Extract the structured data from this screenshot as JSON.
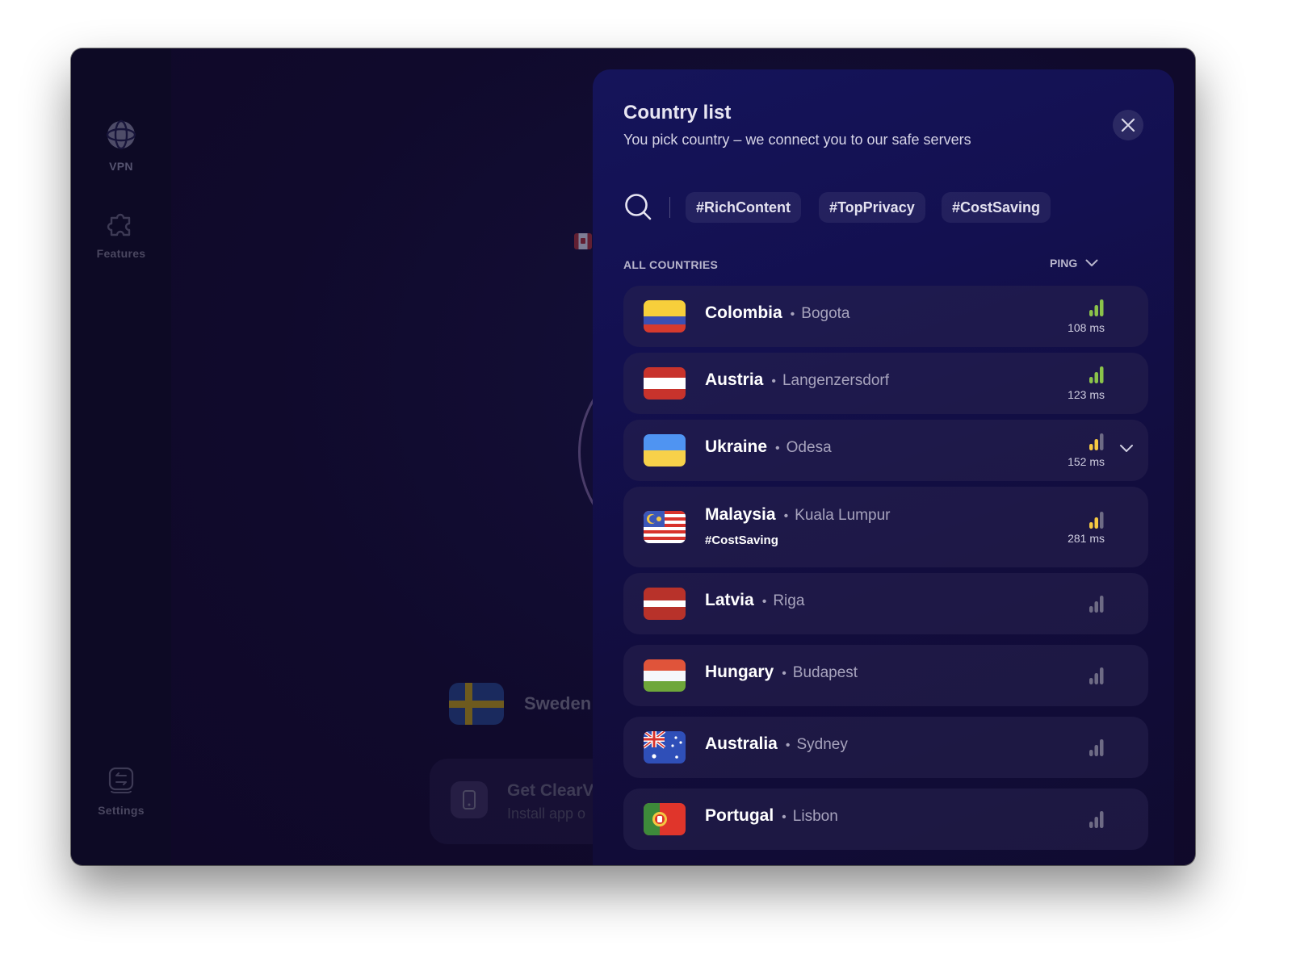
{
  "window": {
    "close_button": "close"
  },
  "sidebar": {
    "items": [
      {
        "label": "VPN",
        "icon": "globe-icon",
        "active": true
      },
      {
        "label": "Features",
        "icon": "puzzle-icon",
        "active": false
      },
      {
        "label": "Settings",
        "icon": "settings-icon",
        "active": false
      }
    ]
  },
  "background": {
    "current_location": "Sweden",
    "promo": {
      "title": "Get ClearV",
      "subtitle": "Install app o"
    }
  },
  "panel": {
    "title": "Country list",
    "subtitle": "You pick country – we connect you to our safe servers",
    "tags": [
      "#RichContent",
      "#TopPrivacy",
      "#CostSaving"
    ],
    "section_label": "ALL COUNTRIES",
    "sort_label": "PING",
    "colors": {
      "signal_good": "#8bc34a",
      "signal_medium": "#f5c842",
      "signal_inactive": "#6e6b85"
    },
    "countries": [
      {
        "name": "Colombia",
        "city": "Bogota",
        "ping": "108 ms",
        "signal": "good",
        "bars_active": 3,
        "tag": null,
        "expandable": false
      },
      {
        "name": "Austria",
        "city": "Langenzersdorf",
        "ping": "123 ms",
        "signal": "good",
        "bars_active": 3,
        "tag": null,
        "expandable": false
      },
      {
        "name": "Ukraine",
        "city": "Odesa",
        "ping": "152 ms",
        "signal": "medium",
        "bars_active": 2,
        "tag": null,
        "expandable": true
      },
      {
        "name": "Malaysia",
        "city": "Kuala Lumpur",
        "ping": "281 ms",
        "signal": "medium",
        "bars_active": 2,
        "tag": "#CostSaving",
        "expandable": false
      },
      {
        "name": "Latvia",
        "city": "Riga",
        "ping": null,
        "signal": "unknown",
        "bars_active": 0,
        "tag": null,
        "expandable": false
      },
      {
        "name": "Hungary",
        "city": "Budapest",
        "ping": null,
        "signal": "unknown",
        "bars_active": 0,
        "tag": null,
        "expandable": false
      },
      {
        "name": "Australia",
        "city": "Sydney",
        "ping": null,
        "signal": "unknown",
        "bars_active": 0,
        "tag": null,
        "expandable": false
      },
      {
        "name": "Portugal",
        "city": "Lisbon",
        "ping": null,
        "signal": "unknown",
        "bars_active": 0,
        "tag": null,
        "expandable": false
      }
    ]
  }
}
